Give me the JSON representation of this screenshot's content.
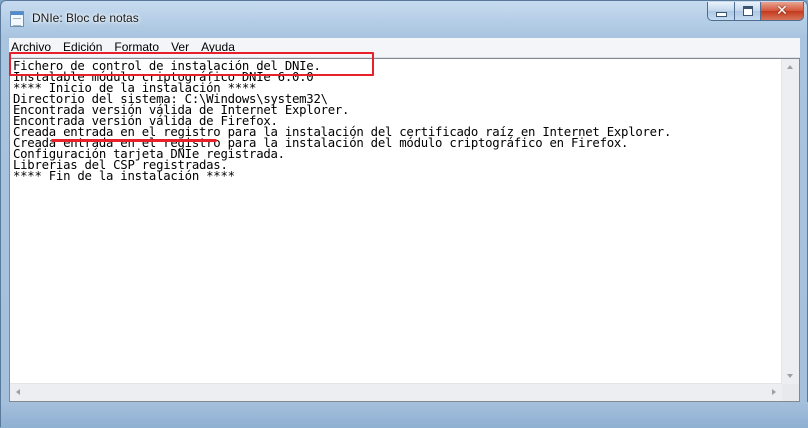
{
  "window": {
    "title": "DNIe: Bloc de notas",
    "controls": [
      "minimize",
      "maximize",
      "close"
    ],
    "icon": "notepad-icon"
  },
  "menu": {
    "items": [
      "Archivo",
      "Edición",
      "Formato",
      "Ver",
      "Ayuda"
    ]
  },
  "document": {
    "lines": [
      "Fichero de control de instalación del DNIe.",
      "Instalable módulo criptográfico DNIe 6.0.0",
      "**** Inicio de la instalación ****",
      "Directorio del sistema: C:\\Windows\\system32\\",
      "Encontrada versión válida de Internet Explorer.",
      "Encontrada versión válida de Firefox.",
      "Creada entrada en el registro para la instalación del certificado raíz en Internet Explorer.",
      "Creada entrada en el registro para la instalación del módulo criptográfico en Firefox.",
      "Configuración tarjeta DNIe registrada.",
      "Librerias del CSP registradas.",
      "**** Fin de la instalación ****"
    ]
  },
  "annotations": {
    "color": "#e8202a",
    "box_lines": [
      5,
      6
    ],
    "underline_line": 11
  }
}
